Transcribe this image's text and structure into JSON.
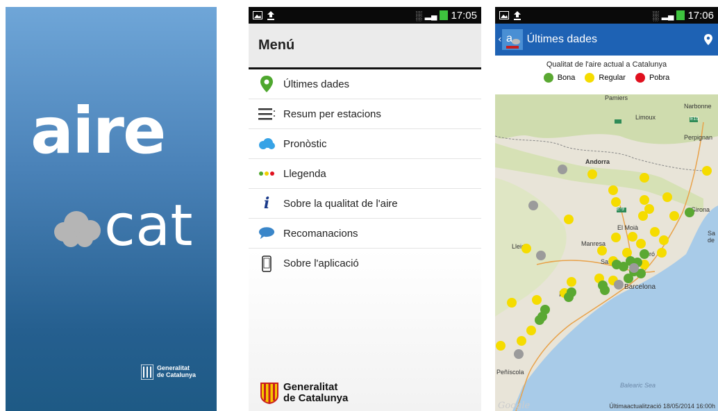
{
  "splash": {
    "logo_aire": "aire",
    "logo_cat": "cat",
    "generalitat_line1": "Generalitat",
    "generalitat_line2": "de Catalunya"
  },
  "status_menu": {
    "time": "17:05"
  },
  "status_map": {
    "time": "17:06"
  },
  "menu": {
    "title": "Menú",
    "items": [
      {
        "label": "Últimes dades",
        "icon": "map-pin-icon"
      },
      {
        "label": "Resum per estacions",
        "icon": "list-icon"
      },
      {
        "label": "Pronòstic",
        "icon": "cloud-icon"
      },
      {
        "label": "Llegenda",
        "icon": "legend-dots-icon"
      },
      {
        "label": "Sobre la qualitat de l'aire",
        "icon": "info-icon"
      },
      {
        "label": "Recomanacions",
        "icon": "speech-bubble-icon"
      },
      {
        "label": "Sobre l'aplicació",
        "icon": "phone-icon"
      }
    ],
    "generalitat_line1": "Generalitat",
    "generalitat_line2": "de Catalunya"
  },
  "map_screen": {
    "title": "Últimes dades",
    "subtitle": "Qualitat de l'aire actual a Catalunya",
    "legend": [
      {
        "label": "Bona",
        "color": "#5aa832"
      },
      {
        "label": "Regular",
        "color": "#f5dc00"
      },
      {
        "label": "Pobra",
        "color": "#e0101e"
      }
    ],
    "place_labels": {
      "pamiers": "Pamiers",
      "limoux": "Limoux",
      "narbonne": "Narbonne",
      "perpignan": "Perpignan",
      "andorra": "Andorra",
      "girona": "Girona",
      "el_moia": "El Moià",
      "manresa": "Manresa",
      "lleida": "Lleida",
      "barcelona": "Barcelona",
      "peniscola": "Peñíscola",
      "balearic_sea": "Balearic Sea",
      "sabadell": "Sab",
      "mataro": "ró",
      "reus": "R",
      "sant_feliu": "Sa",
      "sant_feliu2": "de"
    },
    "road_labels": {
      "e15": "E15",
      "e9": "E-9"
    },
    "last_update": "Últimaactualització 18/05/2014  16:00h",
    "google": "Google"
  }
}
